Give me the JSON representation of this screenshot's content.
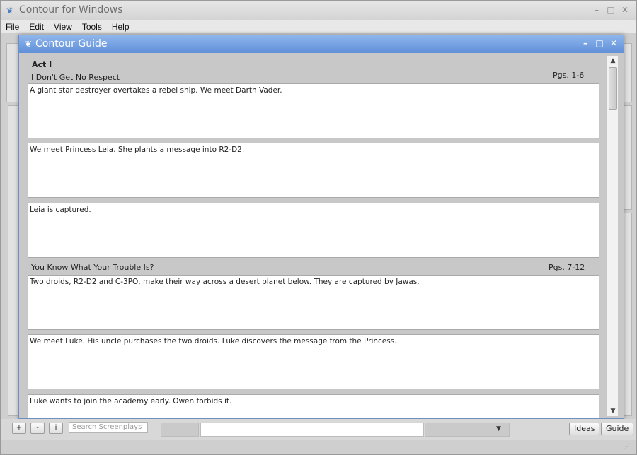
{
  "outer": {
    "title": "Contour for Windows",
    "minimize": "–",
    "restore": "□",
    "close": "✕"
  },
  "menu": [
    "File",
    "Edit",
    "View",
    "Tools",
    "Help"
  ],
  "guide": {
    "title": "Contour Guide",
    "minimize": "–",
    "maximize": "□",
    "close": "✕",
    "act_label": "Act I",
    "sequences": [
      {
        "title": "I Don't Get No Respect",
        "pages": "Pgs. 1-6",
        "beats": [
          "A giant star destroyer overtakes a rebel ship. We meet Darth Vader.",
          "We meet Princess Leia. She plants a message into R2-D2.",
          "Leia is captured."
        ]
      },
      {
        "title": "You Know What Your Trouble Is?",
        "pages": "Pgs. 7-12",
        "beats": [
          "Two droids, R2-D2 and C-3PO, make their way across a desert planet below. They are captured by Jawas.",
          "We meet Luke. His uncle purchases the two droids. Luke discovers the message from the Princess.",
          "Luke wants to join the academy early. Owen forbids it."
        ]
      }
    ]
  },
  "toolbar": {
    "add_label": "+",
    "remove_label": "-",
    "info_label": "i",
    "search_placeholder": "Search Screenplays",
    "ideas_label": "Ideas",
    "guide_label": "Guide"
  },
  "icons": {
    "app": "bulb-icon",
    "scroll_up": "▲",
    "scroll_down": "▼",
    "dropdown": "▼",
    "grip": "⋰"
  }
}
